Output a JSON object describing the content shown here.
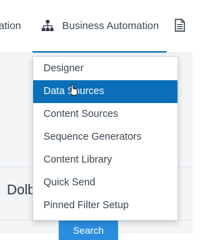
{
  "nav": {
    "partial_tab_label": "ation",
    "active_tab_label": "Business Automation",
    "active_tab_icon": "sitemap-icon",
    "next_tab_icon": "document-icon"
  },
  "dropdown": {
    "items": [
      {
        "label": "Designer",
        "selected": false
      },
      {
        "label": "Data Sources",
        "selected": true
      },
      {
        "label": "Content Sources",
        "selected": false
      },
      {
        "label": "Sequence Generators",
        "selected": false
      },
      {
        "label": "Content Library",
        "selected": false
      },
      {
        "label": "Quick Send",
        "selected": false
      },
      {
        "label": "Pinned Filter Setup",
        "selected": false
      }
    ]
  },
  "background": {
    "partial_heading": "Dolb",
    "search_button_label": "Search"
  },
  "colors": {
    "accent": "#0a6fb8",
    "button": "#2a8ddf"
  }
}
